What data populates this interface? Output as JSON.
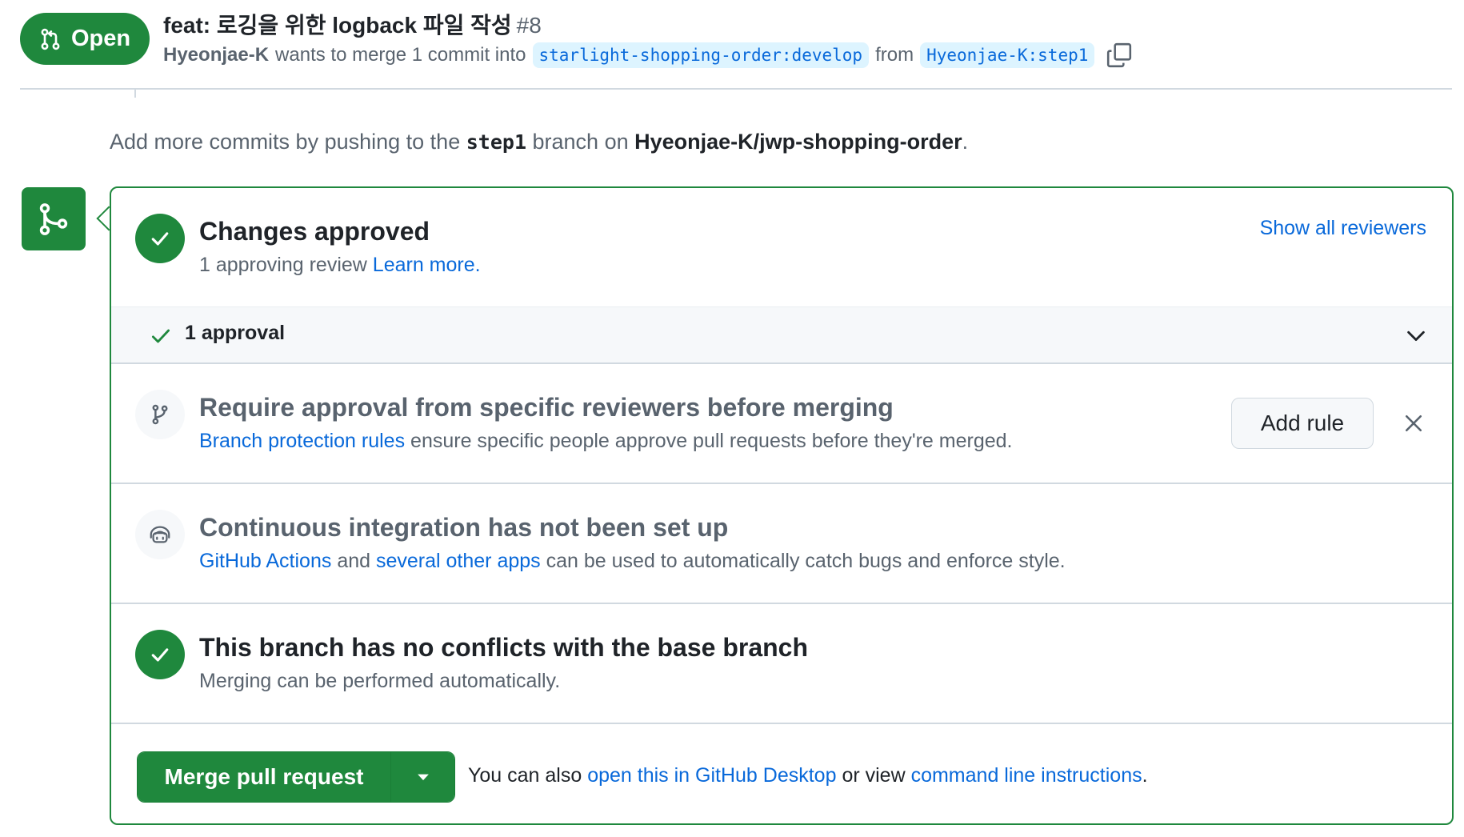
{
  "header": {
    "state": "Open",
    "title": "feat: 로깅을 위한 logback 파일 작성",
    "number": "#8",
    "author": "Hyeonjae-K",
    "meta_text": "wants to merge 1 commit into",
    "base_branch": "starlight-shopping-order:develop",
    "from_text": "from",
    "head_branch": "Hyeonjae-K:step1"
  },
  "hint": {
    "prefix": "Add more commits by pushing to the",
    "branch": "step1",
    "middle": "branch on",
    "repo": "Hyeonjae-K/jwp-shopping-order",
    "suffix": "."
  },
  "review": {
    "title": "Changes approved",
    "subtitle": "1 approving review",
    "learn_more": "Learn more.",
    "show_all": "Show all reviewers",
    "approval_count": "1 approval"
  },
  "rule": {
    "title": "Require approval from specific reviewers before merging",
    "link": "Branch protection rules",
    "text": "ensure specific people approve pull requests before they're merged.",
    "button": "Add rule"
  },
  "ci": {
    "title": "Continuous integration has not been set up",
    "link1": "GitHub Actions",
    "and": "and",
    "link2": "several other apps",
    "text": "can be used to automatically catch bugs and enforce style."
  },
  "conflicts": {
    "title": "This branch has no conflicts with the base branch",
    "subtitle": "Merging can be performed automatically."
  },
  "merge": {
    "button": "Merge pull request",
    "prefix": "You can also",
    "link1": "open this in GitHub Desktop",
    "middle": "or view",
    "link2": "command line instructions",
    "suffix": "."
  },
  "colors": {
    "green": "#1f883d",
    "link": "#0969da",
    "muted": "#59636e",
    "border": "#d1d9e0"
  }
}
